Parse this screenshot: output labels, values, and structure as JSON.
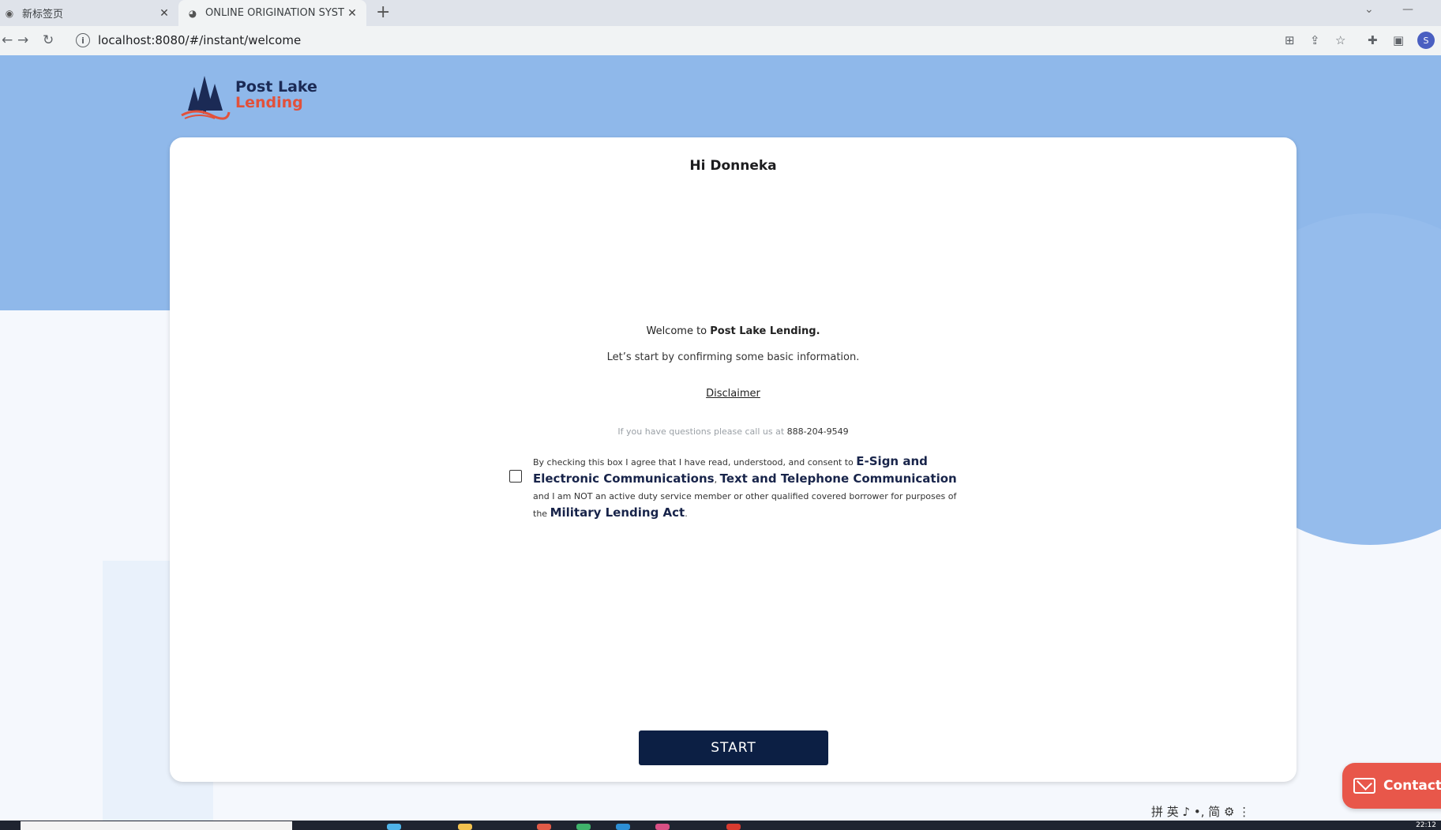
{
  "browser": {
    "tabs": [
      {
        "label": "新标签页",
        "active": false
      },
      {
        "label": "ONLINE ORIGINATION SYSTEM",
        "active": true
      }
    ],
    "new_tab": "+",
    "url": "localhost:8080/#/instant/welcome",
    "profile_initial": "S"
  },
  "logo": {
    "line1": "Post Lake",
    "line2": "Lending"
  },
  "card": {
    "greeting": "Hi Donneka",
    "welcome_prefix": "Welcome to ",
    "welcome_brand": "Post Lake Lending.",
    "basic_info": "Let’s start by confirming some basic information.",
    "disclaimer": "Disclaimer",
    "questions_text": "If you have questions please call us at ",
    "phone": "888-204-9549",
    "consent": {
      "checked": false,
      "part1": "By checking this box I agree that I have read, understood, and consent to ",
      "link1": "E-Sign and Electronic Communications",
      "sep": ", ",
      "link2": "Text and Telephone Communication",
      "part2": " and I am NOT an active duty service member or other qualified covered borrower for purposes of the ",
      "link3": "Military Lending Act",
      "end": "."
    },
    "start_button": "START"
  },
  "contact_button": "Contact",
  "ime_bar": "拼 英 ♪ •, 简 ⚙ ⋮",
  "clock": "22:12",
  "colors": {
    "hero": "#8fb8ea",
    "navy": "#0c1f44",
    "brand_red": "#e2513b",
    "contact": "#e8574a"
  }
}
